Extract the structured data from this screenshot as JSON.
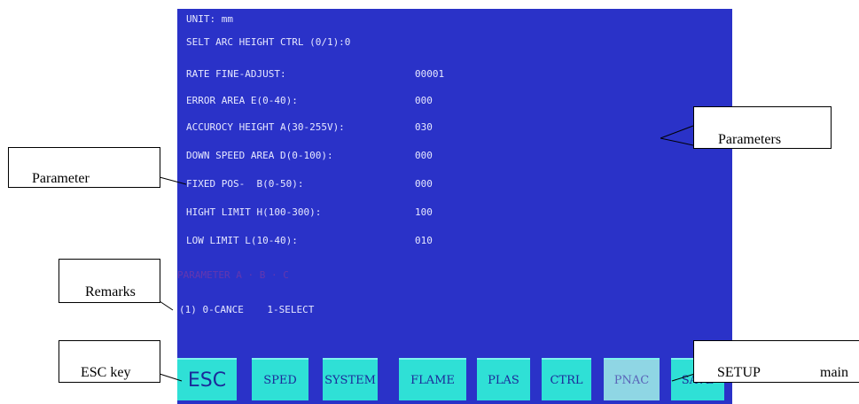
{
  "screen": {
    "params": [
      {
        "label": "UNIT: mm",
        "value": ""
      },
      {
        "label": "SELT ARC HEIGHT CTRL (0/1):0",
        "value": ""
      },
      {
        "label": "RATE FINE-ADJUST:",
        "value": "00001"
      },
      {
        "label": "ERROR AREA E(0-40):",
        "value": "000"
      },
      {
        "label": "ACCUROCY HEIGHT A(30-255V):",
        "value": "030"
      },
      {
        "label": "DOWN SPEED AREA D(0-100):",
        "value": "000"
      },
      {
        "label": "FIXED POS-  B(0-50):",
        "value": "000"
      },
      {
        "label": "HIGHT LIMIT H(100-300):",
        "value": "100"
      },
      {
        "label": "LOW LIMIT L(10-40):",
        "value": "010"
      }
    ],
    "remark_faded": "PARAMETER A · B · C",
    "remark": "(1) 0-CANCE    1-SELECT"
  },
  "function_keys": [
    "ESC",
    "SPED",
    "SYSTEM",
    "FLAME",
    "PLAS",
    "CTRL",
    "PNAC",
    "SAVE"
  ],
  "callouts": {
    "parameters": "Parameters",
    "parameter": "Parameter",
    "remarks": "Remarks",
    "esc_key": "ESC key",
    "setup_left": "SETUP",
    "setup_right": "main"
  },
  "colors": {
    "screen_bg": "#2a32c8",
    "key_bg": "#2fe0d6",
    "key_dim_bg": "#8fd6e4"
  }
}
